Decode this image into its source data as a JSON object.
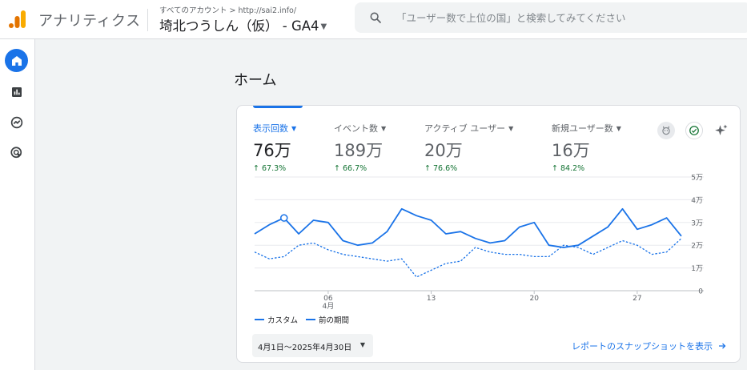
{
  "header": {
    "app_title": "アナリティクス",
    "breadcrumb": "すべてのアカウント > http://sai2.info/",
    "property": "埼北つうしん（仮） - GA4",
    "search_placeholder": "「ユーザー数で上位の国」と検索してみてください"
  },
  "sidebar": {
    "items": [
      "home-icon",
      "reports-icon",
      "explore-icon",
      "advertising-icon"
    ]
  },
  "page": {
    "title": "ホーム"
  },
  "metrics": [
    {
      "label": "表示回数",
      "value": "76万",
      "change": "67.3%",
      "selected": true
    },
    {
      "label": "イベント数",
      "value": "189万",
      "change": "66.7%"
    },
    {
      "label": "アクティブ ユーザー",
      "value": "20万",
      "change": "76.6%"
    },
    {
      "label": "新規ユーザー数",
      "value": "16万",
      "change": "84.2%"
    }
  ],
  "chart_data": {
    "type": "line",
    "x_tick_labels": [
      "06",
      "13",
      "20",
      "27"
    ],
    "x_tick_sublabel": "4月",
    "y_tick_labels": [
      "0",
      "1万",
      "2万",
      "3万",
      "4万",
      "5万"
    ],
    "ylim": [
      0,
      50000
    ],
    "grid": true,
    "legend_position": "bottom-left",
    "series": [
      {
        "name": "カスタム",
        "style": "solid",
        "color": "#1a73e8",
        "values": [
          25000,
          29000,
          32000,
          25000,
          31000,
          30000,
          22000,
          20000,
          21000,
          26000,
          36000,
          33000,
          31000,
          25000,
          26000,
          23000,
          21000,
          22000,
          28000,
          30000,
          20000,
          19000,
          20000,
          24000,
          28000,
          36000,
          27000,
          29000,
          32000,
          24000
        ]
      },
      {
        "name": "前の期間",
        "style": "dashed",
        "color": "#1a73e8",
        "values": [
          17000,
          14000,
          15000,
          20000,
          21000,
          18000,
          16000,
          15000,
          14000,
          13000,
          14000,
          6000,
          9000,
          12000,
          13000,
          19000,
          17000,
          16000,
          16000,
          15000,
          15000,
          20000,
          19000,
          16000,
          19000,
          22000,
          20000,
          16000,
          17000,
          23000
        ]
      }
    ]
  },
  "legend": {
    "current": "カスタム",
    "previous": "前の期間"
  },
  "date_range": "4月1日～2025年4月30日",
  "snapshot_link": "レポートのスナップショットを表示"
}
